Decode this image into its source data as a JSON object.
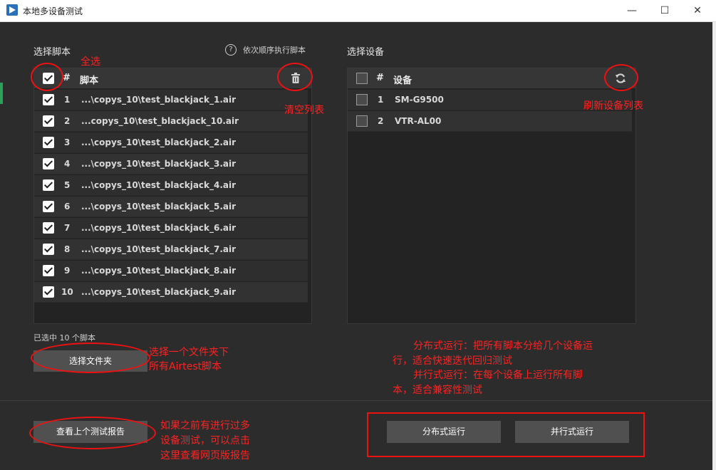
{
  "window": {
    "title": "本地多设备测试",
    "minimize": "—",
    "maximize": "☐",
    "close": "✕"
  },
  "scripts": {
    "label": "选择脚本",
    "hint_icon": "?",
    "hint": "依次顺序执行脚本",
    "header_num": "#",
    "header_name": "脚本",
    "rows": [
      {
        "num": "1",
        "name": "...\\copys_10\\test_blackjack_1.air",
        "checked": true
      },
      {
        "num": "2",
        "name": "...copys_10\\test_blackjack_10.air",
        "checked": true
      },
      {
        "num": "3",
        "name": "...\\copys_10\\test_blackjack_2.air",
        "checked": true
      },
      {
        "num": "4",
        "name": "...\\copys_10\\test_blackjack_3.air",
        "checked": true
      },
      {
        "num": "5",
        "name": "...\\copys_10\\test_blackjack_4.air",
        "checked": true
      },
      {
        "num": "6",
        "name": "...\\copys_10\\test_blackjack_5.air",
        "checked": true
      },
      {
        "num": "7",
        "name": "...\\copys_10\\test_blackjack_6.air",
        "checked": true
      },
      {
        "num": "8",
        "name": "...\\copys_10\\test_blackjack_7.air",
        "checked": true
      },
      {
        "num": "9",
        "name": "...\\copys_10\\test_blackjack_8.air",
        "checked": true
      },
      {
        "num": "10",
        "name": "...\\copys_10\\test_blackjack_9.air",
        "checked": true
      }
    ],
    "selected_count": "已选中 10 个脚本",
    "select_folder": "选择文件夹"
  },
  "devices": {
    "label": "选择设备",
    "header_num": "#",
    "header_name": "设备",
    "rows": [
      {
        "num": "1",
        "name": "SM-G9500",
        "checked": false
      },
      {
        "num": "2",
        "name": "VTR-AL00",
        "checked": false
      }
    ]
  },
  "footer": {
    "view_report": "查看上个测试报告",
    "distributed_run": "分布式运行",
    "parallel_run": "并行式运行"
  },
  "annotations": {
    "select_all": "全选",
    "clear_list": "清空列表",
    "refresh_devices": "刷新设备列表",
    "folder_line1": "选择一个文件夹下",
    "folder_line2": "所有Airtest脚本",
    "mode_line1": "分布式运行：把所有脚本分给几个设备运",
    "mode_line2": "行，适合快速迭代回归测试",
    "mode_line3": "并行式运行：在每个设备上运行所有脚",
    "mode_line4": "本，适合兼容性测试",
    "report_line1": "如果之前有进行过多",
    "report_line2": "设备测试，可以点击",
    "report_line3": "这里查看网页版报告"
  },
  "colors": {
    "annotation": "#ff2222",
    "background": "#2c2c2c",
    "panel": "#232323"
  }
}
